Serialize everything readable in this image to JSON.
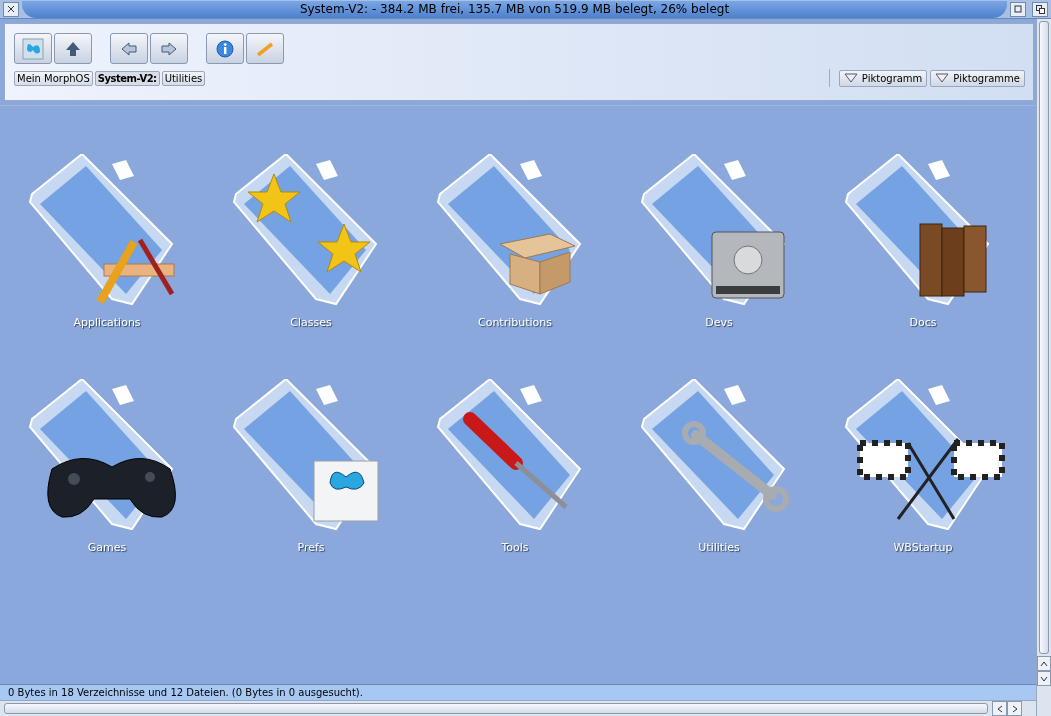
{
  "window": {
    "title": "System-V2: - 384.2 MB frei, 135.7 MB von 519.9 MB belegt, 26% belegt"
  },
  "breadcrumbs": [
    {
      "label": "Mein MorphOS",
      "selected": false
    },
    {
      "label": "System-V2:",
      "selected": true
    },
    {
      "label": "Utilities",
      "selected": false
    }
  ],
  "view_menus": [
    "Piktogramm",
    "Piktogramme"
  ],
  "icons": [
    {
      "label": "Applications",
      "kind": "tools"
    },
    {
      "label": "Classes",
      "kind": "stars"
    },
    {
      "label": "Contributions",
      "kind": "box"
    },
    {
      "label": "Devs",
      "kind": "drive"
    },
    {
      "label": "Docs",
      "kind": "books"
    },
    {
      "label": "Games",
      "kind": "gamepad"
    },
    {
      "label": "Prefs",
      "kind": "butterfly"
    },
    {
      "label": "Tools",
      "kind": "screwdriver"
    },
    {
      "label": "Utilities",
      "kind": "wrench"
    },
    {
      "label": "WBStartup",
      "kind": "flags"
    }
  ],
  "status_bar": "0 Bytes in 18 Verzeichnisse und 12 Dateien. (0 Bytes in 0 ausgesucht)."
}
